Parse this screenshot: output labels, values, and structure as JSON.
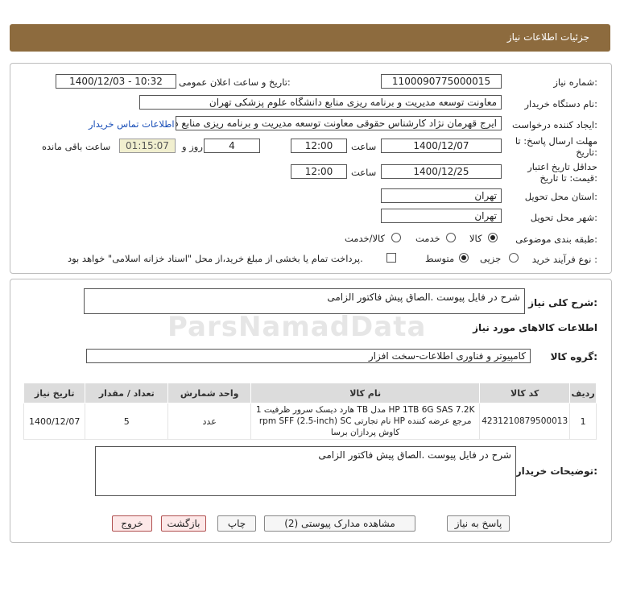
{
  "header": {
    "title": "جزئیات اطلاعات نیاز"
  },
  "form": {
    "need_number_label": "شماره نیاز:",
    "need_number": "1100090775000015",
    "announce_label": "تاریخ و ساعت اعلان عمومی:",
    "announce_value": "1400/12/03 - 10:32",
    "buyer_org_label": "نام دستگاه خریدار:",
    "buyer_org": "معاونت توسعه مدیریت و برنامه ریزی منابع دانشگاه علوم پزشکی تهران",
    "creator_label": "ایجاد کننده درخواست:",
    "creator": "ایرج قهرمان نژاد کارشناس حقوقی معاونت توسعه مدیریت و برنامه ریزی منابع دا",
    "contact_link": "اطلاعات تماس خریدار",
    "deadline_label_1": "مهلت ارسال پاسخ: تا",
    "deadline_label_2": "تاریخ:",
    "deadline_date": "1400/12/07",
    "time_label": "ساعت",
    "deadline_time": "12:00",
    "days": "4",
    "days_label": "روز و",
    "remaining": "01:15:07",
    "remaining_label": "ساعت باقی مانده",
    "validity_label_1": "حداقل تاریخ اعتبار",
    "validity_label_2": "قیمت: تا تاریخ:",
    "validity_date": "1400/12/25",
    "validity_time": "12:00",
    "province_label": "استان محل تحویل:",
    "province": "تهران",
    "city_label": "شهر محل تحویل:",
    "city": "تهران",
    "category_label": "طبقه بندی موضوعی:",
    "category_options": [
      "کالا",
      "خدمت",
      "کالا/خدمت"
    ],
    "category_selected": "کالا",
    "process_label": "نوع فرآیند خرید :",
    "process_options": [
      "جزیی",
      "متوسط"
    ],
    "process_selected": "متوسط",
    "payment_note": "پرداخت تمام یا بخشی از مبلغ خرید،از محل \"اسناد خزانه اسلامی\" خواهد بود."
  },
  "details": {
    "summary_label": "شرح کلی نیاز:",
    "summary": "شرح در فایل پیوست .الصاق پیش فاکتور الزامی",
    "goods_info_title": "اطلاعات کالاهای مورد نیاز",
    "goods_group_label": "گروه کالا:",
    "goods_group": "کامپیوتر و فناوری اطلاعات-سخت افزار"
  },
  "table": {
    "headers": [
      "ردیف",
      "کد کالا",
      "نام کالا",
      "واحد شمارش",
      "تعداد / مقدار",
      "تاریخ نیاز"
    ],
    "rows": [
      {
        "row": "1",
        "code": "4231210879500013",
        "name_line1": "هارد دیسک سرور ظرفیت 1 TB مدل HP 1TB 6G SAS 7.2K",
        "name_line2": "rpm SFF (2.5-inch) SC نام تجارتی HP مرجع عرضه کننده",
        "name_line3": "کاوش پردازان برسا",
        "unit": "عدد",
        "qty": "5",
        "date": "1400/12/07"
      }
    ]
  },
  "buyer_notes": {
    "label": "توضیحات خریدار:",
    "text": "شرح در فایل پیوست .الصاق پیش فاکتور الزامی"
  },
  "buttons": {
    "reply": "پاسخ به نیاز",
    "attachments": "مشاهده مدارک پیوستی (2)",
    "print": "چاپ",
    "back": "بازگشت",
    "exit": "خروج"
  },
  "watermark": {
    "brand": "ParsNamadData"
  }
}
